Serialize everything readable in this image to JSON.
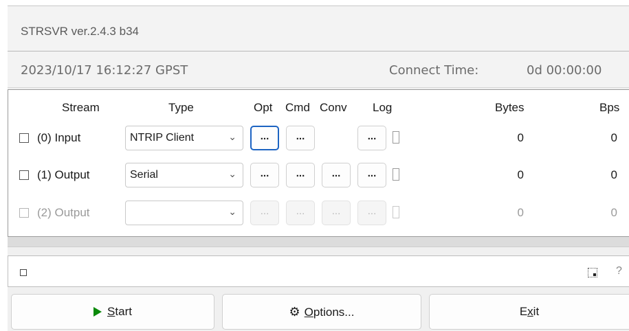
{
  "window": {
    "title": "STRSVR ver.2.4.3 b34"
  },
  "time_panel": {
    "datetime": "2023/10/17 16:12:27 GPST",
    "connect_label": "Connect Time:",
    "connect_value": "0d 00:00:00"
  },
  "headers": {
    "stream": "Stream",
    "type": "Type",
    "opt": "Opt",
    "cmd": "Cmd",
    "conv": "Conv",
    "log": "Log",
    "bytes": "Bytes",
    "bps": "Bps"
  },
  "rows": [
    {
      "label": "(0) Input",
      "type": "NTRIP Client",
      "opt": "...",
      "cmd": "...",
      "log": "...",
      "bytes": "0",
      "bps": "0",
      "enabled": true,
      "checked": false
    },
    {
      "label": "(1) Output",
      "type": "Serial",
      "opt": "...",
      "cmd": "...",
      "conv": "...",
      "log": "...",
      "bytes": "0",
      "bps": "0",
      "enabled": true,
      "checked": false
    },
    {
      "label": "(2) Output",
      "type": "",
      "opt": "...",
      "cmd": "...",
      "conv": "...",
      "log": "...",
      "bytes": "0",
      "bps": "0",
      "enabled": false,
      "checked": false
    }
  ],
  "status_bar": {
    "help": "?"
  },
  "buttons": {
    "start": "Start",
    "start_mnemonic": "S",
    "start_rest": "tart",
    "options_mnemonic": "O",
    "options_rest": "ptions...",
    "exit_pre": "E",
    "exit_mnemonic": "x",
    "exit_post": "it"
  },
  "icons": {
    "start": "play-triangle-icon",
    "options": "gear-icon",
    "dropdown": "chevron-down-icon"
  },
  "colors": {
    "accent": "#1c63c2",
    "start_icon": "#0a8a0a"
  }
}
